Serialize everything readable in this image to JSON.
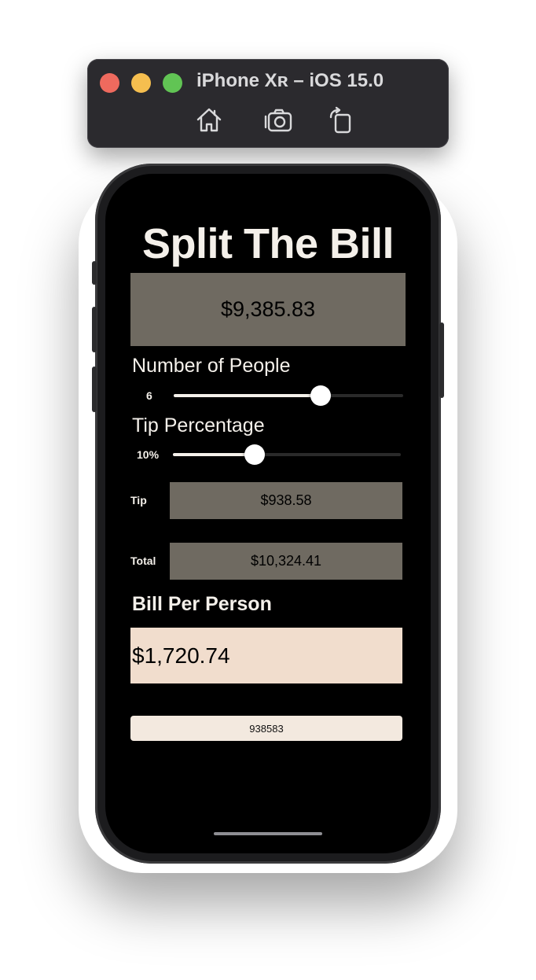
{
  "simulator": {
    "title": "iPhone Xʀ – iOS 15.0",
    "toolbar_icons": [
      "home-icon",
      "screenshot-icon",
      "rotate-icon"
    ]
  },
  "app": {
    "title": "Split The Bill",
    "bill_amount": "$9,385.83",
    "people": {
      "label": "Number of People",
      "value": "6",
      "slider_fraction": 0.64
    },
    "tip": {
      "label": "Tip Percentage",
      "value": "10%",
      "slider_fraction": 0.36
    },
    "tip_row": {
      "label": "Tip",
      "amount": "$938.58"
    },
    "total_row": {
      "label": "Total",
      "amount": "$10,324.41"
    },
    "per_person": {
      "label": "Bill Per Person",
      "amount": "$1,720.74"
    },
    "code": "938583"
  },
  "colors": {
    "background": "#000000",
    "field_dark": "#6f6a61",
    "field_peach": "#f1ddcd",
    "field_light": "#f3e9df",
    "text_light": "#f4f0ea"
  }
}
